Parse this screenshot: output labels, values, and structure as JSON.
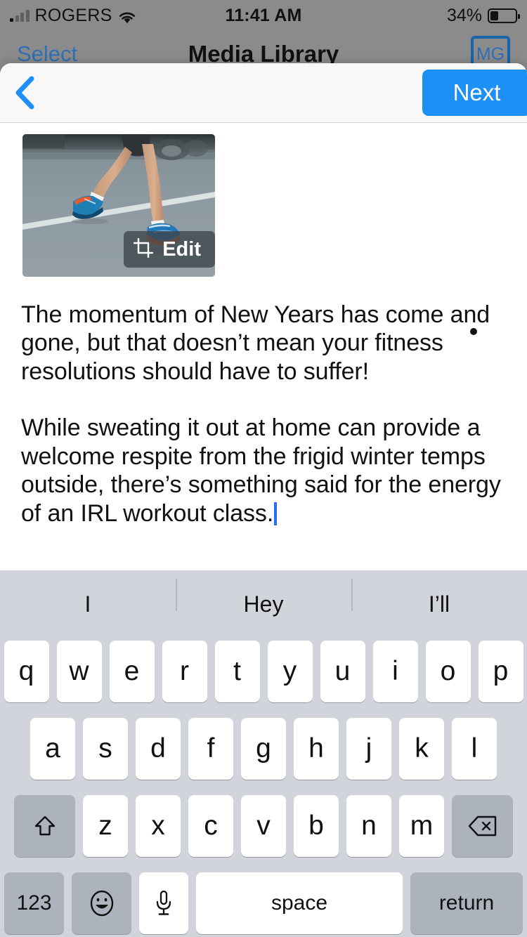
{
  "status_bar": {
    "carrier": "ROGERS",
    "time": "11:41 AM",
    "battery_percent": "34%",
    "battery_level": 34,
    "signal_icon": "signal-bars-icon",
    "wifi_icon": "wifi-icon",
    "battery_icon": "battery-icon"
  },
  "background_screen": {
    "left_action": "Select",
    "title": "Media Library",
    "avatar_initials": "MG"
  },
  "sheet": {
    "back_icon": "chevron-left-icon",
    "next_label": "Next",
    "accent_color": "#1d90f5"
  },
  "composer": {
    "image_alt": "runner-legs-on-road",
    "edit_label": "Edit",
    "edit_icon": "crop-icon",
    "paragraphs": [
      "The momentum of New Years has come and gone, but that doesn’t mean your fitness resolutions should have to suffer!",
      "While sweating it out at home can provide a welcome respite from the frigid winter temps outside, there’s something said for the energy of an IRL workout class."
    ]
  },
  "keyboard": {
    "predictions": [
      "I",
      "Hey",
      "I’ll"
    ],
    "row1": [
      "q",
      "w",
      "e",
      "r",
      "t",
      "y",
      "u",
      "i",
      "o",
      "p"
    ],
    "row2": [
      "a",
      "s",
      "d",
      "f",
      "g",
      "h",
      "j",
      "k",
      "l"
    ],
    "row3": [
      "z",
      "x",
      "c",
      "v",
      "b",
      "n",
      "m"
    ],
    "shift_icon": "shift-icon",
    "backspace_icon": "backspace-icon",
    "numbers_label": "123",
    "emoji_icon": "emoji-smiley-icon",
    "dictation_icon": "microphone-icon",
    "space_label": "space",
    "return_label": "return"
  }
}
